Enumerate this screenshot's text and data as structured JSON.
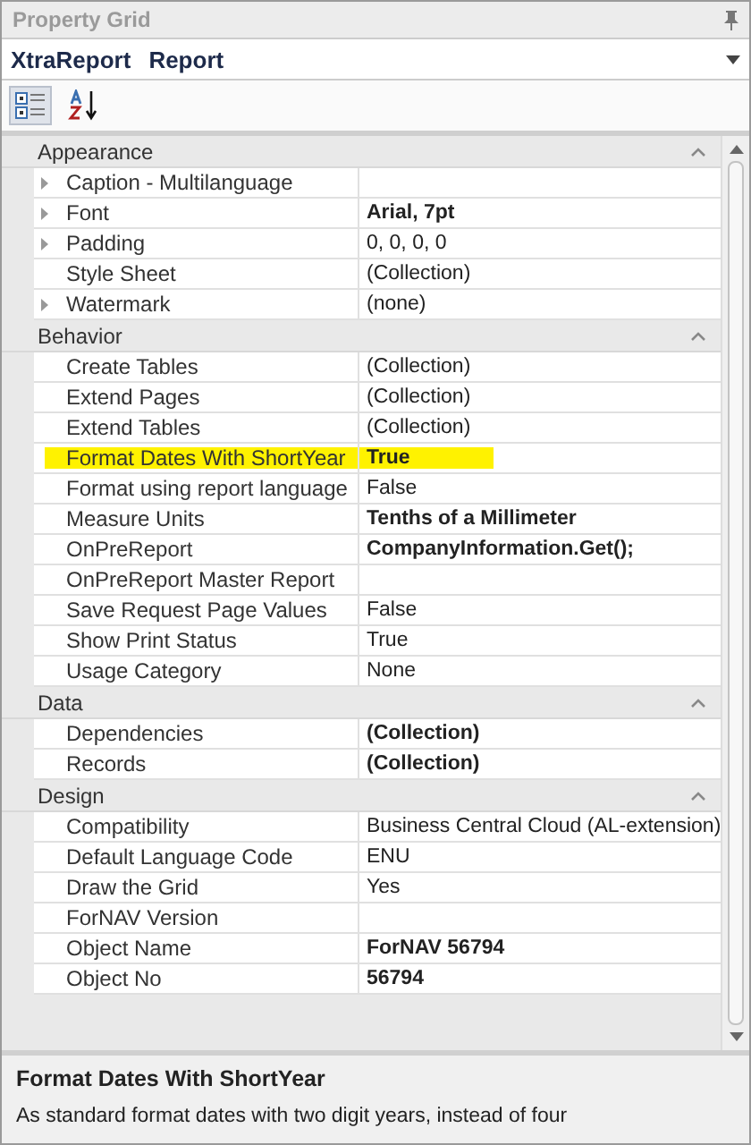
{
  "panel": {
    "title": "Property Grid"
  },
  "object_selector": {
    "name": "XtraReport",
    "type": "Report"
  },
  "toolbar": [
    {
      "kind": "categorized",
      "selected": true
    },
    {
      "kind": "alphabetical",
      "selected": false
    }
  ],
  "categories": [
    {
      "name": "Appearance",
      "expanded": true,
      "properties": [
        {
          "name": "Caption - Multilanguage",
          "expandable": true,
          "highlighted": false
        },
        {
          "name": "Font",
          "value": "Arial, 7pt",
          "expandable": true,
          "bold": true,
          "highlighted": false
        },
        {
          "name": "Padding",
          "value": "0, 0, 0, 0",
          "expandable": true,
          "bold": false,
          "highlighted": false
        },
        {
          "name": "Style Sheet",
          "value": "(Collection)",
          "expandable": false,
          "bold": false,
          "highlighted": false
        },
        {
          "name": "Watermark",
          "value": "(none)",
          "expandable": true,
          "bold": false,
          "highlighted": false
        }
      ]
    },
    {
      "name": "Behavior",
      "expanded": true,
      "properties": [
        {
          "name": "Create Tables",
          "value": "(Collection)",
          "expandable": false,
          "bold": false,
          "highlighted": false
        },
        {
          "name": "Extend Pages",
          "value": "(Collection)",
          "expandable": false,
          "bold": false,
          "highlighted": false
        },
        {
          "name": "Extend Tables",
          "value": "(Collection)",
          "expandable": false,
          "bold": false,
          "highlighted": false
        },
        {
          "name": "Format Dates With ShortYear",
          "value": "True",
          "expandable": false,
          "bold": true,
          "highlighted": true
        },
        {
          "name": "Format using report language",
          "value": "False",
          "expandable": false,
          "bold": false,
          "highlighted": false
        },
        {
          "name": "Measure Units",
          "value": "Tenths of a Millimeter",
          "expandable": false,
          "bold": true,
          "highlighted": false
        },
        {
          "name": "OnPreReport",
          "value": "CompanyInformation.Get();",
          "expandable": false,
          "bold": true,
          "highlighted": false
        },
        {
          "name": "OnPreReport Master Report",
          "expandable": false,
          "highlighted": false
        },
        {
          "name": "Save Request Page Values",
          "value": "False",
          "expandable": false,
          "bold": false,
          "highlighted": false
        },
        {
          "name": "Show Print Status",
          "value": "True",
          "expandable": false,
          "bold": false,
          "highlighted": false
        },
        {
          "name": "Usage Category",
          "value": "None",
          "expandable": false,
          "bold": false,
          "highlighted": false
        }
      ]
    },
    {
      "name": "Data",
      "expanded": true,
      "properties": [
        {
          "name": "Dependencies",
          "value": "(Collection)",
          "expandable": false,
          "bold": true,
          "highlighted": false
        },
        {
          "name": "Records",
          "value": "(Collection)",
          "expandable": false,
          "bold": true,
          "highlighted": false
        }
      ]
    },
    {
      "name": "Design",
      "expanded": true,
      "properties": [
        {
          "name": "Compatibility",
          "value": "Business Central Cloud (AL-extension)",
          "expandable": false,
          "bold": false,
          "highlighted": false
        },
        {
          "name": "Default Language Code",
          "value": "ENU",
          "expandable": false,
          "bold": false,
          "highlighted": false
        },
        {
          "name": "Draw the Grid",
          "value": "Yes",
          "expandable": false,
          "bold": false,
          "highlighted": false
        },
        {
          "name": "ForNAV Version",
          "expandable": false,
          "highlighted": false
        },
        {
          "name": "Object Name",
          "value": "ForNAV 56794",
          "expandable": false,
          "bold": true,
          "highlighted": false
        },
        {
          "name": "Object No",
          "value": "56794",
          "expandable": false,
          "bold": true,
          "highlighted": false
        }
      ]
    }
  ],
  "description": {
    "title": "Format Dates With ShortYear",
    "text": "As standard format dates with two digit years, instead of four"
  }
}
